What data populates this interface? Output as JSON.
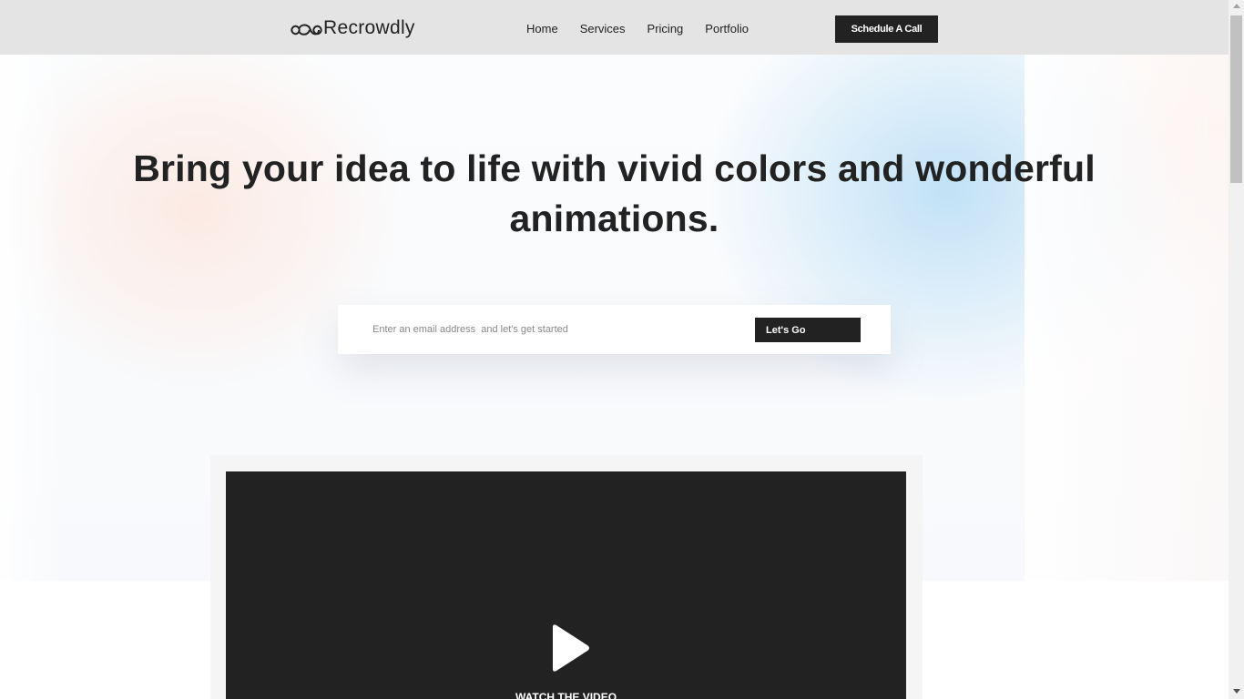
{
  "header": {
    "logo_text": "Recrowdly",
    "logo_icon": "infinity-logo-icon",
    "nav": [
      {
        "label": "Home"
      },
      {
        "label": "Services"
      },
      {
        "label": "Pricing"
      },
      {
        "label": "Portfolio"
      }
    ],
    "cta_label": "Schedule A Call"
  },
  "hero": {
    "headline": "Bring your idea to life with vivid colors and wonderful animations.",
    "email_placeholder": "Enter an email address  and let's get started",
    "submit_label": "Let's Go"
  },
  "video": {
    "play_icon": "play-icon",
    "label": "WATCH THE VIDEO"
  },
  "colors": {
    "accent_dark": "#222222",
    "nav_bg": "#e4e4e4"
  }
}
